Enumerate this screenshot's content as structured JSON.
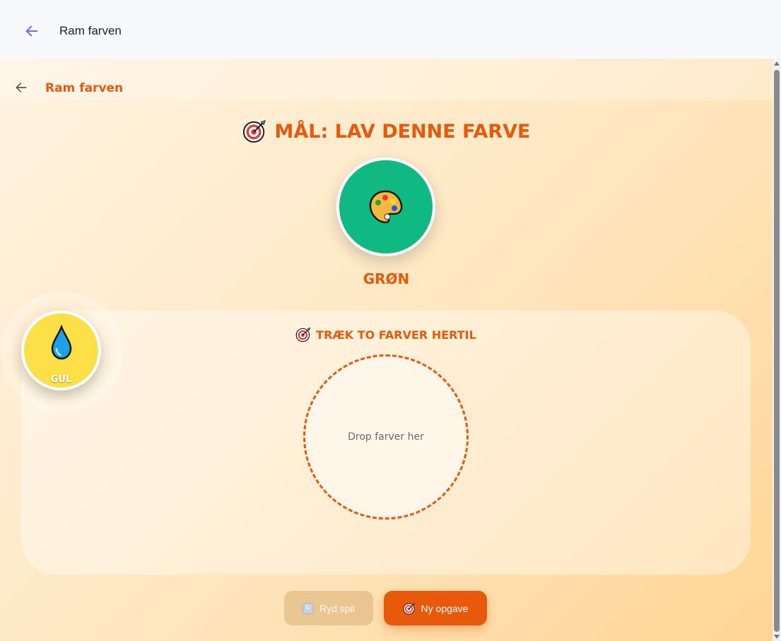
{
  "app_bar": {
    "title": "Ram farven"
  },
  "header": {
    "title": "Ram farven"
  },
  "goal": {
    "heading": "MÅL: LAV DENNE FARVE",
    "target_color_name": "GRØN",
    "target_color": "#10b981"
  },
  "mix": {
    "heading": "TRÆK TO FARVER HERTIL",
    "drop_placeholder": "Drop farver her"
  },
  "palette": {
    "chips": [
      {
        "label": "GUL",
        "color": "#fde047"
      }
    ]
  },
  "actions": {
    "clear_label": "Ryd spil",
    "new_label": "Ny opgave"
  },
  "icons": {
    "back": "arrow-left-icon",
    "target": "direct-hit-icon",
    "palette": "artist-palette-icon",
    "drop": "droplet-icon",
    "clear": "counterclockwise-arrows-icon"
  },
  "colors": {
    "accent": "#e8590c",
    "app_back": "#8b5cf6"
  }
}
